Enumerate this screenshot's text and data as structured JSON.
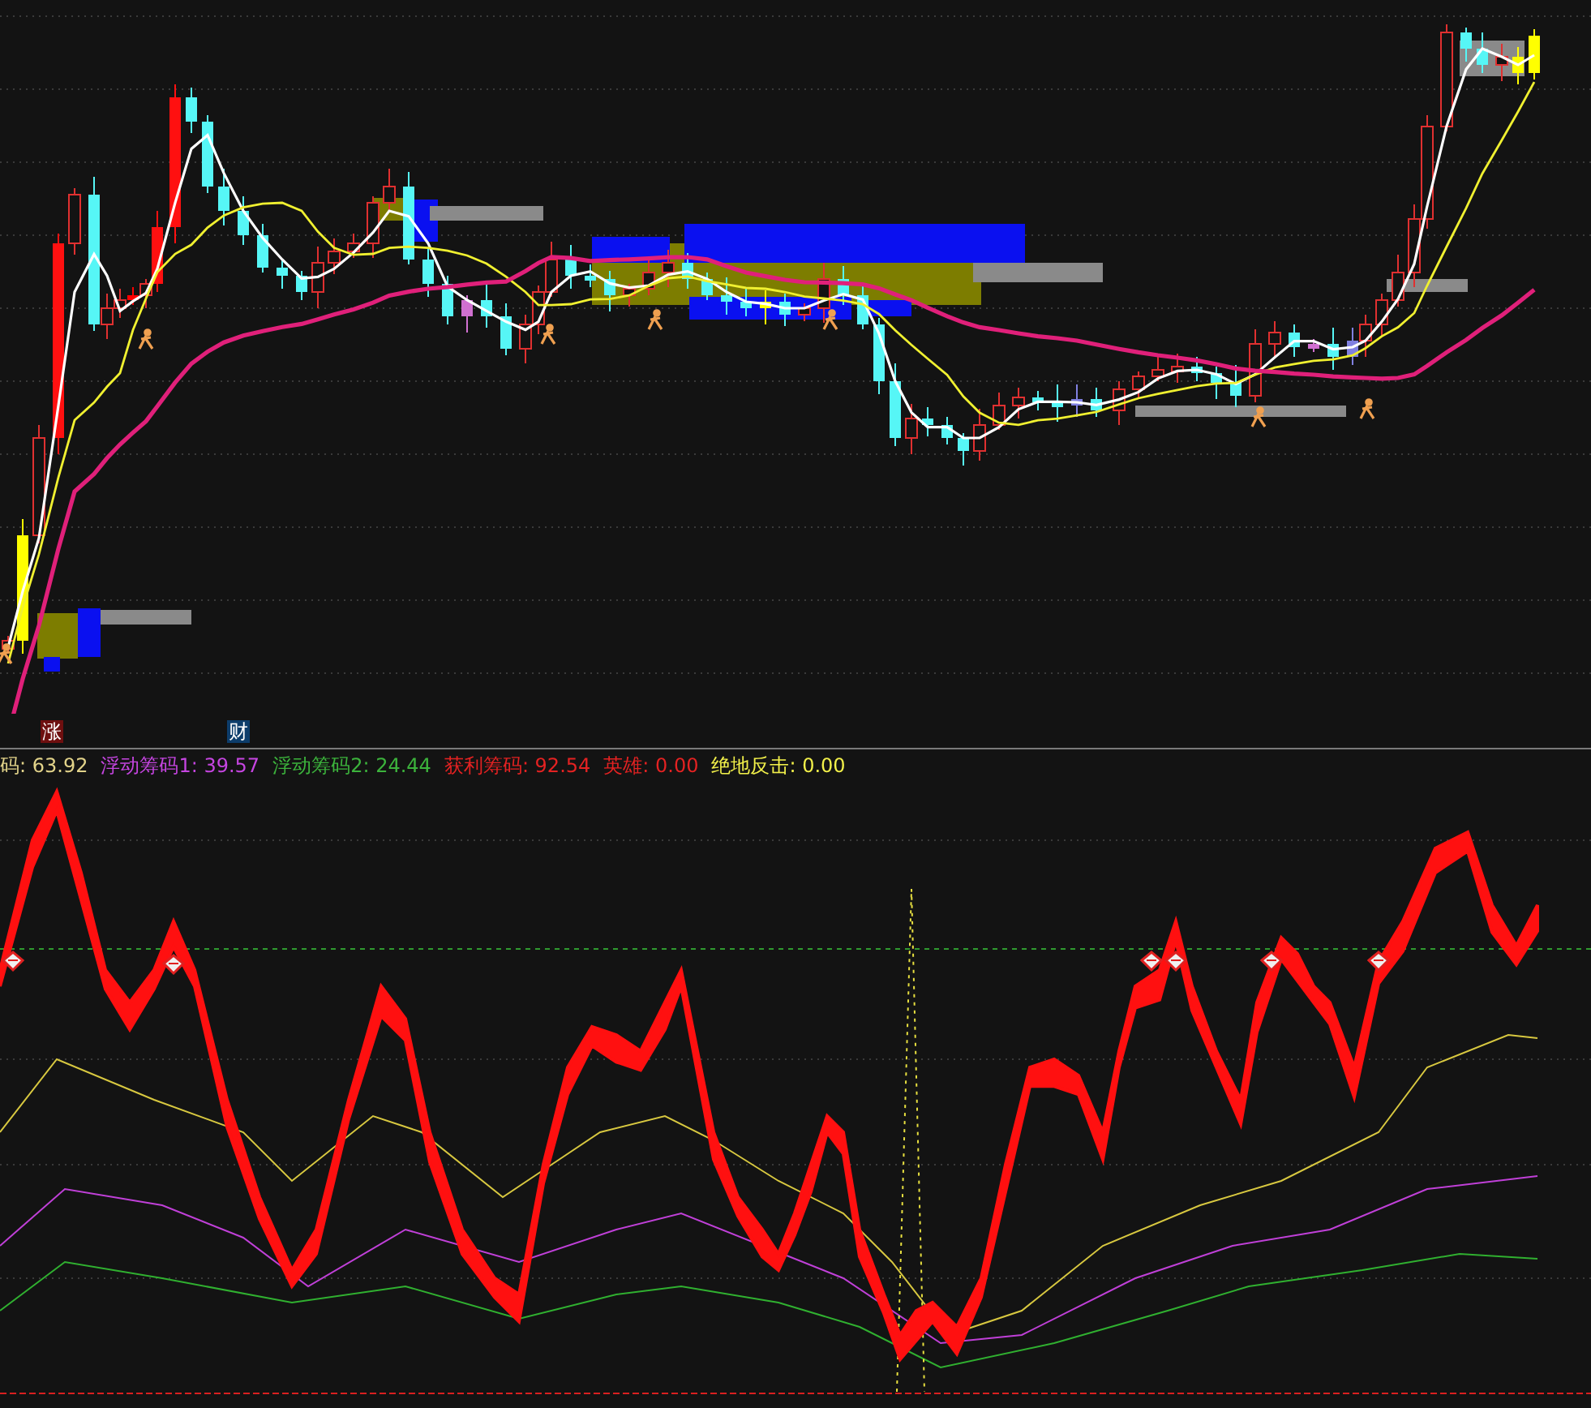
{
  "price_panel": {
    "markers": [
      {
        "text": "涨",
        "color": "#6e0f0f"
      },
      {
        "text": "财",
        "color": "#0d3d6b"
      }
    ]
  },
  "indicator_panel": {
    "legend": [
      {
        "text": "码: 63.92",
        "color": "#e2d38a"
      },
      {
        "text": "浮动筹码1: 39.57",
        "color": "#c545e0"
      },
      {
        "text": "浮动筹码2: 24.44",
        "color": "#3cb33c"
      },
      {
        "text": "获利筹码: 92.54",
        "color": "#e42222"
      },
      {
        "text": "英雄: 0.00",
        "color": "#e42222"
      },
      {
        "text": "绝地反击: 0.00",
        "color": "#f2f04a"
      }
    ]
  }
}
